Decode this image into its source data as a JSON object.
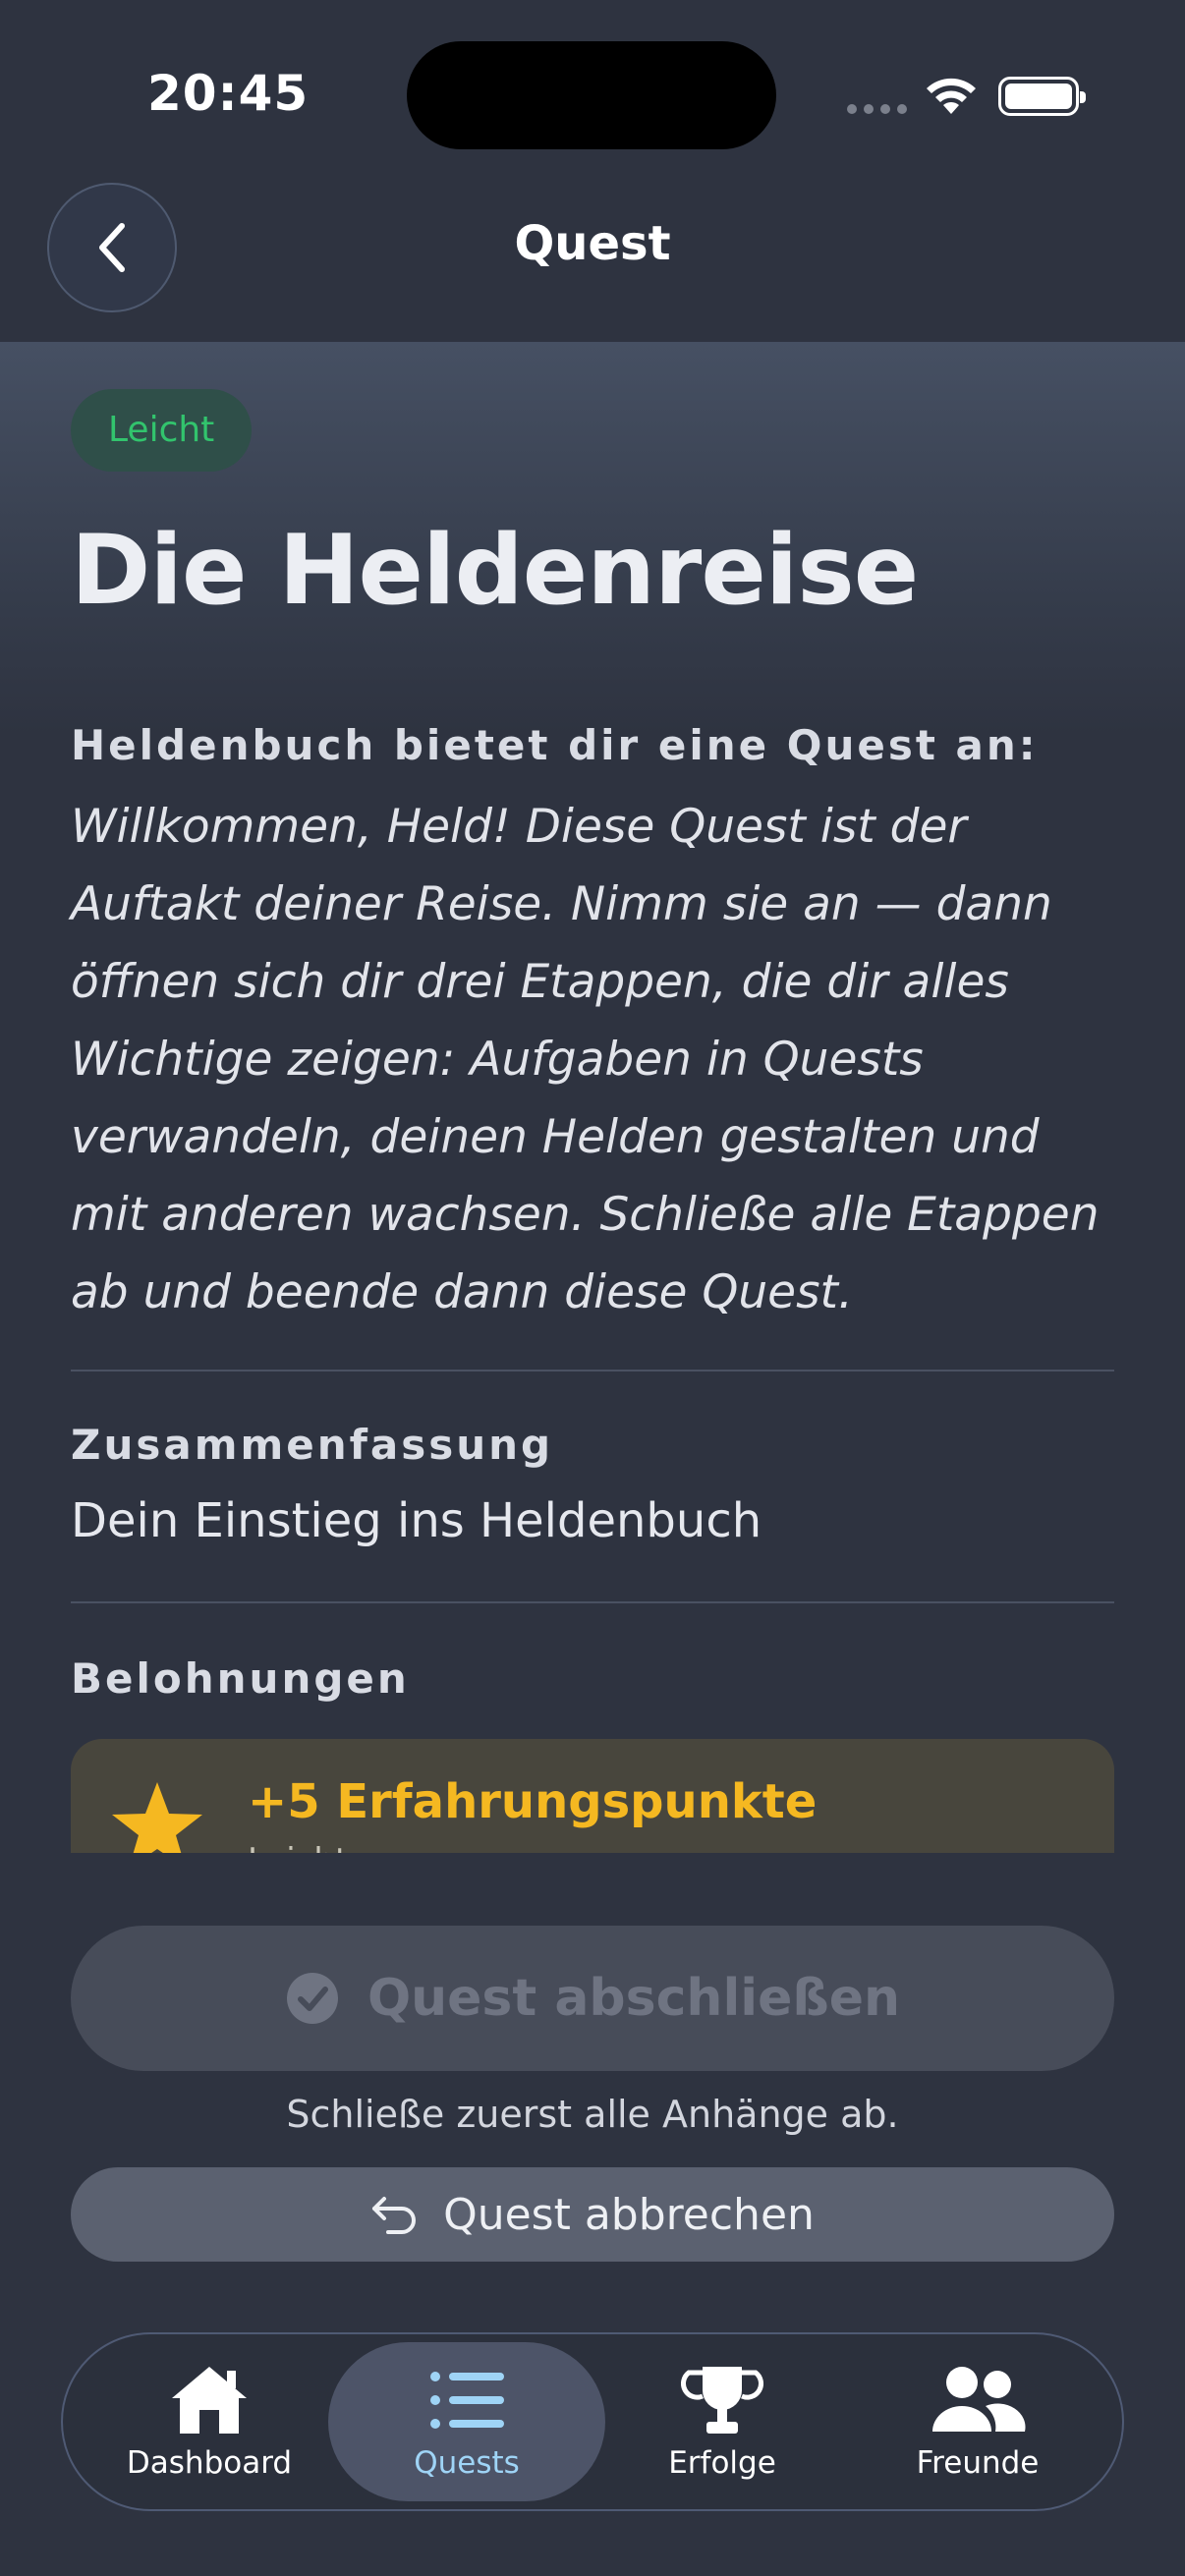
{
  "status_bar": {
    "time": "20:45"
  },
  "header": {
    "title": "Quest"
  },
  "quest": {
    "difficulty": "Leicht",
    "title": "Die Heldenreise",
    "offer_label": "Heldenbuch bietet dir eine Quest an:",
    "offer_text": "Willkommen, Held! Diese Quest ist der Auftakt deiner Reise. Nimm sie an — dann öffnen sich dir drei Etappen, die dir alles Wichtige zeigen: Aufgaben in Quests verwandeln, deinen Helden gestalten und mit anderen wachsen. Schließe alle Etappen ab und beende dann diese Quest.",
    "summary_label": "Zusammenfassung",
    "summary_text": "Dein Einstieg ins Heldenbuch",
    "rewards_label": "Belohnungen",
    "rewards": [
      {
        "title": "+5 Erfahrungspunkte",
        "subtitle": "Leicht",
        "icon": "star-icon",
        "color": "#f5b821"
      }
    ]
  },
  "actions": {
    "complete_label": "Quest abschließen",
    "complete_hint": "Schließe zuerst alle Anhänge ab.",
    "abort_label": "Quest abbrechen"
  },
  "tabs": [
    {
      "label": "Dashboard",
      "icon": "house-icon",
      "active": false
    },
    {
      "label": "Quests",
      "icon": "list-icon",
      "active": true
    },
    {
      "label": "Erfolge",
      "icon": "trophy-icon",
      "active": false
    },
    {
      "label": "Freunde",
      "icon": "people-icon",
      "active": false
    }
  ],
  "colors": {
    "background": "#2e3340",
    "accent_easy": "#32c46d",
    "reward": "#f5b821",
    "tab_active": "#9fd4f6"
  }
}
